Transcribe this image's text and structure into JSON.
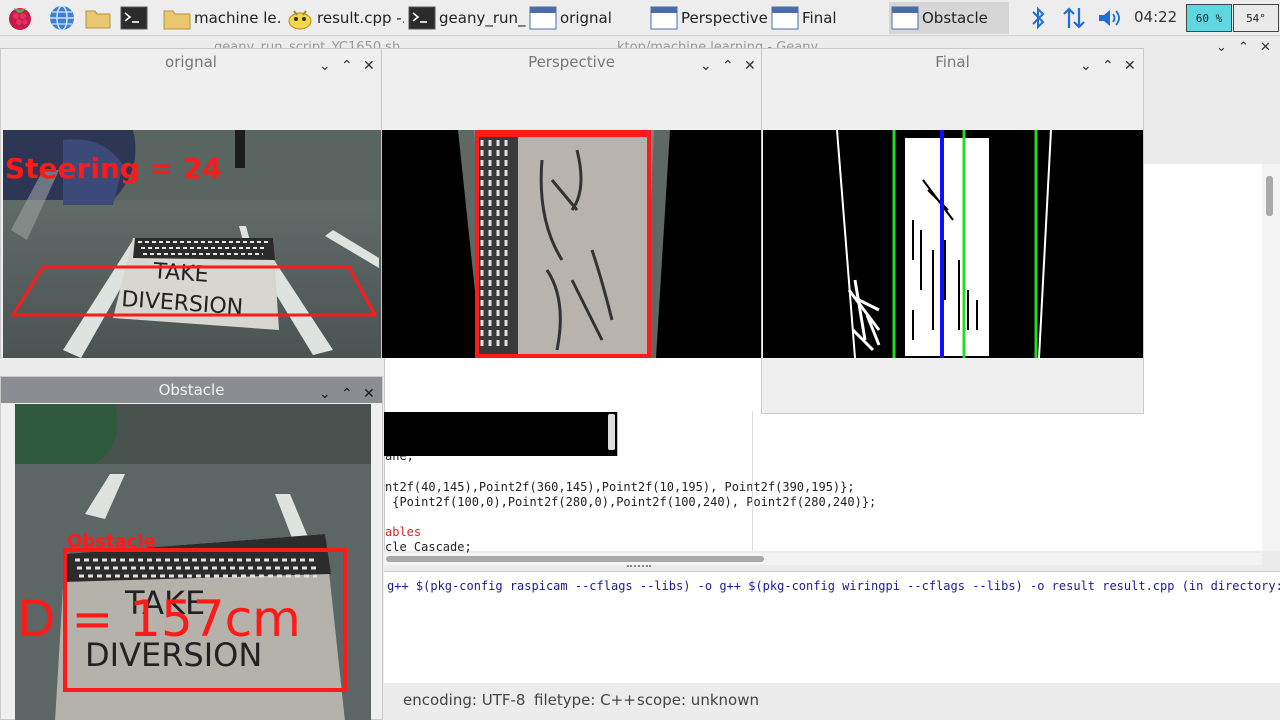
{
  "taskbar": {
    "tasks": [
      {
        "label": "machine le…",
        "icon": "folder-icon"
      },
      {
        "label": "result.cpp -…",
        "icon": "geany-lamp-icon"
      },
      {
        "label": "geany_run_…",
        "icon": "terminal-icon"
      },
      {
        "label": "orignal",
        "icon": "window-icon"
      },
      {
        "label": "Perspective",
        "icon": "window-icon"
      },
      {
        "label": "Final",
        "icon": "window-icon"
      },
      {
        "label": "Obstacle",
        "icon": "window-icon",
        "active": true
      }
    ],
    "clock": "04:22",
    "cpu": "60 %",
    "temp": "54°"
  },
  "geany": {
    "title_left": "geany_run_script_YC1650.sh",
    "title_right": "…ktop/machine learning - Geany",
    "code_lines": [
      "ane;",
      "",
      "nt2f(40,145),Point2f(360,145),Point2f(10,195), Point2f(390,195)};",
      " {Point2f(100,0),Point2f(280,0),Point2f(100,240), Point2f(280,240)};",
      "",
      "ables",
      "cle_Cascade;"
    ],
    "compiler_message": "g++ $(pkg-config raspicam --cflags --libs) -o g++ $(pkg-config wiringpi --cflags --libs) -o result result.cpp (in directory: /home/pi/D",
    "status": {
      "encoding": "encoding: UTF-8",
      "filetype": "filetype: C++",
      "scope": "scope: unknown"
    }
  },
  "windows": {
    "orignal": {
      "title": "orignal",
      "overlay": "Steering = 24",
      "sign_line1": "TAKE",
      "sign_line2": "DIVERSION"
    },
    "perspective": {
      "title": "Perspective"
    },
    "final": {
      "title": "Final"
    },
    "obstacle": {
      "title": "Obstacle",
      "label": "Obstacle",
      "distance": "D = 157cm",
      "sign_line1": "TAKE",
      "sign_line2": "DIVERSION"
    }
  },
  "colors": {
    "overlay_red": "#ff1a1a",
    "lane_green": "#22dd22",
    "center_blue": "#1010ff",
    "cpu_bg": "#5ed8e0"
  }
}
